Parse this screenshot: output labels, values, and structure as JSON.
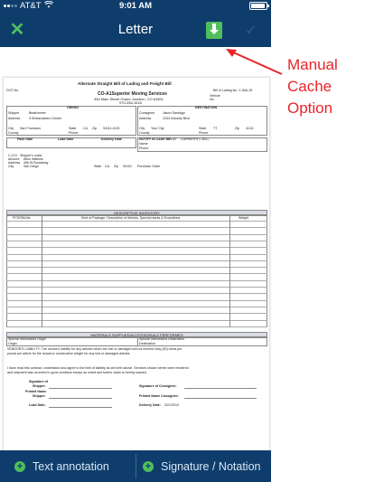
{
  "status_bar": {
    "carrier": "AT&T",
    "time": "9:01 AM"
  },
  "nav": {
    "title": "Letter",
    "close_icon": "close-x-icon",
    "cache_icon": "download-to-device-icon",
    "confirm_icon": "checkmark-icon"
  },
  "annotation": {
    "line1": "Manual",
    "line2": "Cache",
    "line3": "Option",
    "color": "#e8242a"
  },
  "toolbar": {
    "text_annotation_label": "Text annotation",
    "signature_label": "Signature / Notation"
  },
  "document": {
    "title": "Alternate Straight Bill of Lading and Freight Bill",
    "dot_no": "DOT No.",
    "bill_no": "Bill of Lading No. C-506-15",
    "vehicle": "Vehicle",
    "no": "No.",
    "company": "CO-A1Superior Moving Services",
    "address": "454 Main Street  Grand Junction, CO  81601",
    "phone": "970-256-1616",
    "origin": "ORIGIN",
    "destination": "DESTINATION",
    "shipper_label": "Shipper",
    "shipper": "Beatrhomer",
    "consignee_label": "Consignee",
    "consignee": "Jason Santiago",
    "address_label": "Address",
    "origin_address": "3 Embarcadero Center",
    "dest_address": "1234 Industry Blvd",
    "city_label": "City",
    "origin_city": "San Francisco",
    "dest_city": "Your City",
    "state_label": "State",
    "origin_state": "CA",
    "dest_state": "TT",
    "zip_label": "Zip",
    "origin_zip": "94111-2115",
    "dest_zip": "11111",
    "county_label": "County",
    "phone_label": "Phone",
    "pack_date": "Pack Date",
    "load_date": "Load Date",
    "delivery_date": "Delivery Date",
    "notify": "NOTIFY IN CASE OF",
    "relay": "RELAY",
    "carriers_c": "CARRIER'S C-BILL",
    "name_label": "Name",
    "note_cod": "C.O.D.",
    "note_amount": "Amount",
    "date_loaded": "Dated",
    "cod_shipper": "Shipper's costs",
    "amount_val": "Allen Watkins",
    "addr_val": "496 W Broadway",
    "city_val": "San Diego",
    "cod_state": "CA",
    "cod_zip": "92101",
    "purchase": "Purchase Order",
    "desc_header": "DESCRIPTIVE INVENTORY",
    "col_pcs": "PCS/SKU#s",
    "col_kind": "Kind of Package, Description of Articles, Special marks & Exceptions",
    "col_weight": "Weight",
    "materials_header": "MATERIALS SUPPLIED/ACCESSORIALS PERFORMED",
    "special_origin": "Special Instructions Origin",
    "origin_word": "Origin",
    "special_dest": "Special Instructions Destination",
    "dest_word": "Destination",
    "liability": "VENDOR'S LIABILITY: The vendor's liability for any articles which are lost or damaged will not exceed sixty (60) cents per",
    "liability2": "pound per article for the actual or constructive weight for any lost or damaged articles.",
    "read_contract": "I have read this contract, understand and agree to the limit of liability as set forth above.   Services shown herein were rendered",
    "read_contract2": "and shipment was received in good condition except as noted and further claim is hereby waived.",
    "sig_of": "Signature of",
    "sig_shipper": "Shipper:",
    "sig_consignee": "Signature of Consignee:",
    "printed_name": "Printed Name",
    "printed_shipper": "Shipper:",
    "printed_consignee": "Printed Name Consignee:",
    "load_date_label": "Load Date:",
    "delivery_date_label": "Delivery Date:",
    "delivery_date_val": "3/21/2019"
  }
}
